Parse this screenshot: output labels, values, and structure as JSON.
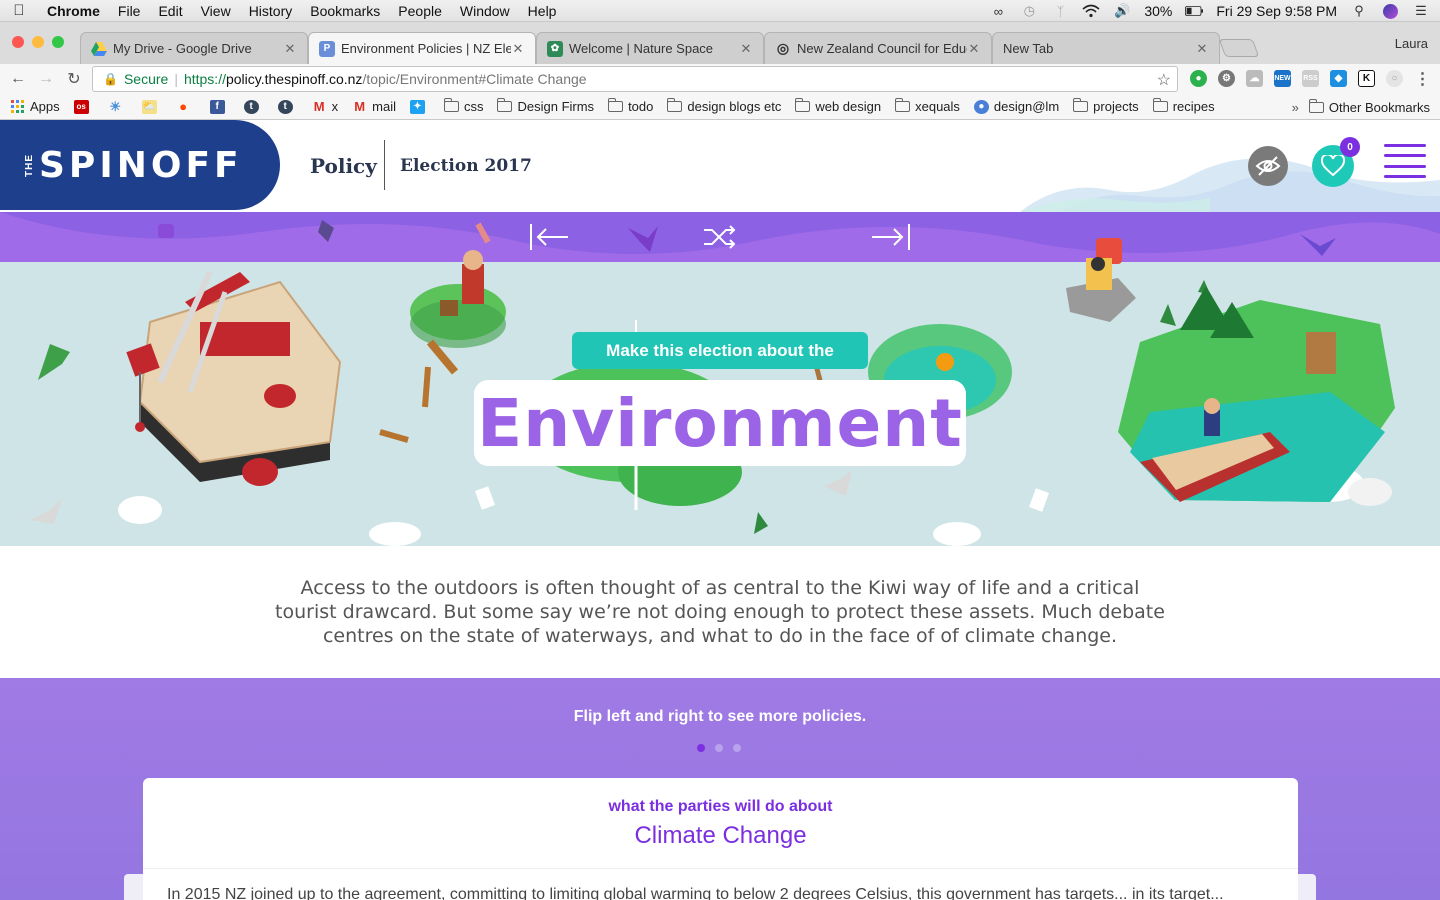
{
  "menubar": {
    "items": [
      "Chrome",
      "File",
      "Edit",
      "View",
      "History",
      "Bookmarks",
      "People",
      "Window",
      "Help"
    ],
    "battery": "30%",
    "clock": "Fri 29 Sep  9:58 PM"
  },
  "tabs": [
    {
      "title": "My Drive - Google Drive",
      "favicon_color": "#1fa463"
    },
    {
      "title": "Environment Policies | NZ Elec",
      "favicon_color": "#6a8fd8",
      "active": true
    },
    {
      "title": "Welcome | Nature Space",
      "favicon_color": "#2e8b57"
    },
    {
      "title": "New Zealand Council for Educa",
      "favicon_color": "#333333"
    },
    {
      "title": "New Tab",
      "favicon_color": "#ffffff"
    }
  ],
  "profile_name": "Laura",
  "omnibox": {
    "secure_label": "Secure",
    "scheme": "https://",
    "host": "policy.thespinoff.co.nz",
    "path": "/topic/Environment#Climate Change"
  },
  "bookmarks": {
    "items": [
      {
        "label": "Apps",
        "type": "apps"
      },
      {
        "label": "",
        "type": "icon",
        "color": "#cc0000"
      },
      {
        "label": "",
        "type": "icon",
        "color": "#4a90d9"
      },
      {
        "label": "",
        "type": "icon",
        "color": "#f5c542"
      },
      {
        "label": "",
        "type": "icon",
        "color": "#ff4500"
      },
      {
        "label": "",
        "type": "icon",
        "color": "#3b5998"
      },
      {
        "label": "",
        "type": "icon",
        "color": "#35465c"
      },
      {
        "label": "",
        "type": "icon",
        "color": "#35465c"
      },
      {
        "label": "x",
        "type": "gmail"
      },
      {
        "label": "mail",
        "type": "gmail"
      },
      {
        "label": "",
        "type": "icon",
        "color": "#1da1f2"
      },
      {
        "label": "css",
        "type": "folder"
      },
      {
        "label": "Design Firms",
        "type": "folder"
      },
      {
        "label": "todo",
        "type": "folder"
      },
      {
        "label": "design blogs etc",
        "type": "folder"
      },
      {
        "label": "web design",
        "type": "folder"
      },
      {
        "label": "xequals",
        "type": "folder"
      },
      {
        "label": "design@lm",
        "type": "globe"
      },
      {
        "label": "projects",
        "type": "folder"
      },
      {
        "label": "recipes",
        "type": "folder"
      }
    ],
    "overflow": "»",
    "other": "Other Bookmarks"
  },
  "site": {
    "logo_small": "THE",
    "logo_main": "SPINOFF",
    "nav_policy": "Policy",
    "nav_election": "Election 2017",
    "saved_count": "0",
    "brand_color": "#7b2fe0"
  },
  "hero": {
    "tagline": "Make this election about the",
    "topic": "Environment"
  },
  "intro": "Access to the outdoors is often thought of as central to the Kiwi way of life and a critical tourist drawcard. But some say we’re not doing enough to protect these assets. Much debate centres on the state of waterways, and what to do in the face of of climate change.",
  "policies": {
    "hint": "Flip left and right to see more policies.",
    "dots": [
      true,
      false,
      false
    ],
    "card_kicker": "what the parties will do about",
    "card_heading": "Climate Change",
    "card_body": "In 2015 NZ joined up to the agreement, committing to limiting global warming to below 2 degrees Celsius, this government has targets... in its target..."
  }
}
